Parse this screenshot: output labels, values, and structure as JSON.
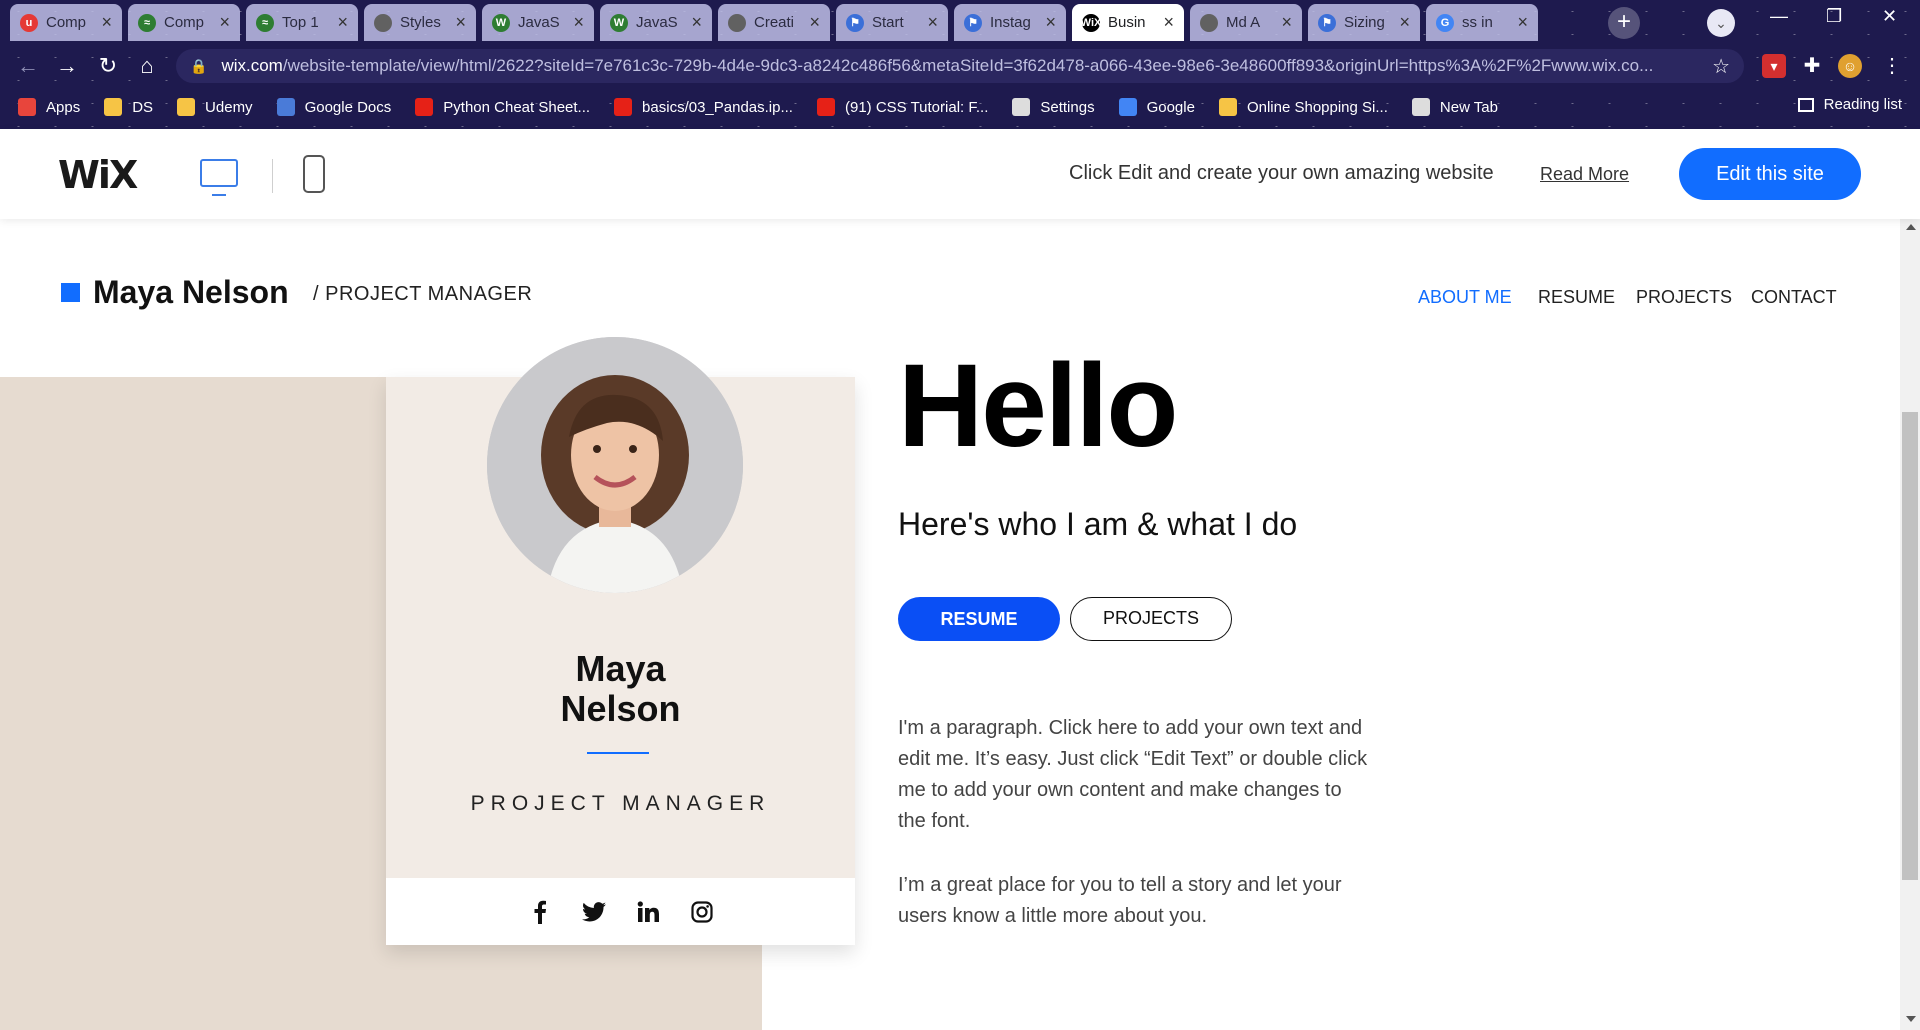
{
  "browser": {
    "tabs": [
      {
        "title": "Comp",
        "color": "#e53935",
        "glyph": "u"
      },
      {
        "title": "Comp",
        "color": "#2e7d32",
        "glyph": "≈"
      },
      {
        "title": "Top 1",
        "color": "#2e7d32",
        "glyph": "≈"
      },
      {
        "title": "Styles",
        "color": "#616161",
        "glyph": ""
      },
      {
        "title": "JavaS",
        "color": "#2e7d32",
        "glyph": "W"
      },
      {
        "title": "JavaS",
        "color": "#2e7d32",
        "glyph": "W"
      },
      {
        "title": "Creati",
        "color": "#616161",
        "glyph": ""
      },
      {
        "title": "Start",
        "color": "#3b6fd8",
        "glyph": "⚑"
      },
      {
        "title": "Instag",
        "color": "#3b6fd8",
        "glyph": "⚑"
      },
      {
        "title": "Busin",
        "color": "#000000",
        "glyph": "WiX",
        "active": true
      },
      {
        "title": "Md A",
        "color": "#616161",
        "glyph": ""
      },
      {
        "title": "Sizing",
        "color": "#3b6fd8",
        "glyph": "⚑"
      },
      {
        "title": "ss in",
        "color": "#4285f4",
        "glyph": "G"
      }
    ],
    "url_host": "wix.com",
    "url_path": "/website-template/view/html/2622?siteId=7e761c3c-729b-4d4e-9dc3-a8242c486f56&metaSiteId=3f62d478-a066-43ee-98e6-3e48600ff893&originUrl=https%3A%2F%2Fwww.wix.co...",
    "bookmarks": [
      {
        "label": "Apps",
        "color": "#e8453c"
      },
      {
        "label": "DS",
        "color": "#f6c445"
      },
      {
        "label": "Udemy",
        "color": "#f6c445"
      },
      {
        "label": "Google Docs",
        "color": "#4a7bd8"
      },
      {
        "label": "Python Cheat Sheet...",
        "color": "#e62117"
      },
      {
        "label": "basics/03_Pandas.ip...",
        "color": "#e62117"
      },
      {
        "label": "(91) CSS Tutorial: F...",
        "color": "#e62117"
      },
      {
        "label": "Settings",
        "color": "#dddddd"
      },
      {
        "label": "Google",
        "color": "#4285f4"
      },
      {
        "label": "Online Shopping Si...",
        "color": "#f6c445"
      },
      {
        "label": "New Tab",
        "color": "#dddddd"
      }
    ],
    "reading_list": "Reading list"
  },
  "wixbar": {
    "logo": "WiX",
    "message": "Click Edit and create your own amazing website",
    "read_more": "Read More",
    "edit_button": "Edit this site"
  },
  "site": {
    "brand_name": "Maya Nelson",
    "brand_role": "/ PROJECT MANAGER",
    "nav": [
      "ABOUT ME",
      "RESUME",
      "PROJECTS",
      "CONTACT"
    ],
    "card": {
      "name_line1": "Maya",
      "name_line2": "Nelson",
      "role": "PROJECT MANAGER"
    },
    "hello": "Hello",
    "subhead": "Here's who I am & what I do",
    "btn_resume": "RESUME",
    "btn_projects": "PROJECTS",
    "para1": "I'm a paragraph. Click here to add your own text and edit me. It’s easy. Just click “Edit Text” or double click me to add your own content and make changes to the font.",
    "para2": "I’m a great place for you to tell a story and let your users know a little more about you."
  },
  "colors": {
    "accent": "#116dff",
    "button_blue": "#0a4ff5",
    "beige": "#e6dbd0",
    "card": "#f2ebe5"
  }
}
